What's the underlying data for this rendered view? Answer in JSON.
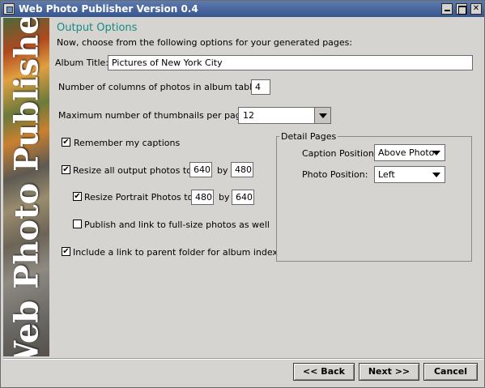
{
  "window": {
    "title": "Web Photo Publisher Version 0.4"
  },
  "sidebar": {
    "logo_text": "Web Photo Publisher"
  },
  "page": {
    "heading": "Output Options",
    "intro": "Now, choose from the following options for your generated pages:"
  },
  "album_title": {
    "label": "Album Title:",
    "value": "Pictures of New York City"
  },
  "columns": {
    "label": "Number of columns of photos in album table:",
    "value": "4"
  },
  "thumbnails": {
    "label": "Maximum number of thumbnails per page:",
    "value": "12"
  },
  "options": {
    "remember_captions": {
      "label": "Remember my captions",
      "checked": true
    },
    "resize_all": {
      "label": "Resize all output photos to",
      "width": "640",
      "by": "by",
      "height": "480",
      "checked": true
    },
    "resize_portrait": {
      "label": "Resize Portrait Photos to",
      "width": "480",
      "by": "by",
      "height": "640",
      "checked": true
    },
    "publish_fullsize": {
      "label": "Publish and link to full-size photos as well",
      "checked": false
    },
    "parent_link": {
      "label": "Include a link to parent folder for album index",
      "checked": true
    }
  },
  "detail_pages": {
    "title": "Detail Pages",
    "caption_position": {
      "label": "Caption Position:",
      "value": "Above Photo"
    },
    "photo_position": {
      "label": "Photo Position:",
      "value": "Left"
    }
  },
  "buttons": {
    "back": "<< Back",
    "next": "Next >>",
    "cancel": "Cancel"
  }
}
